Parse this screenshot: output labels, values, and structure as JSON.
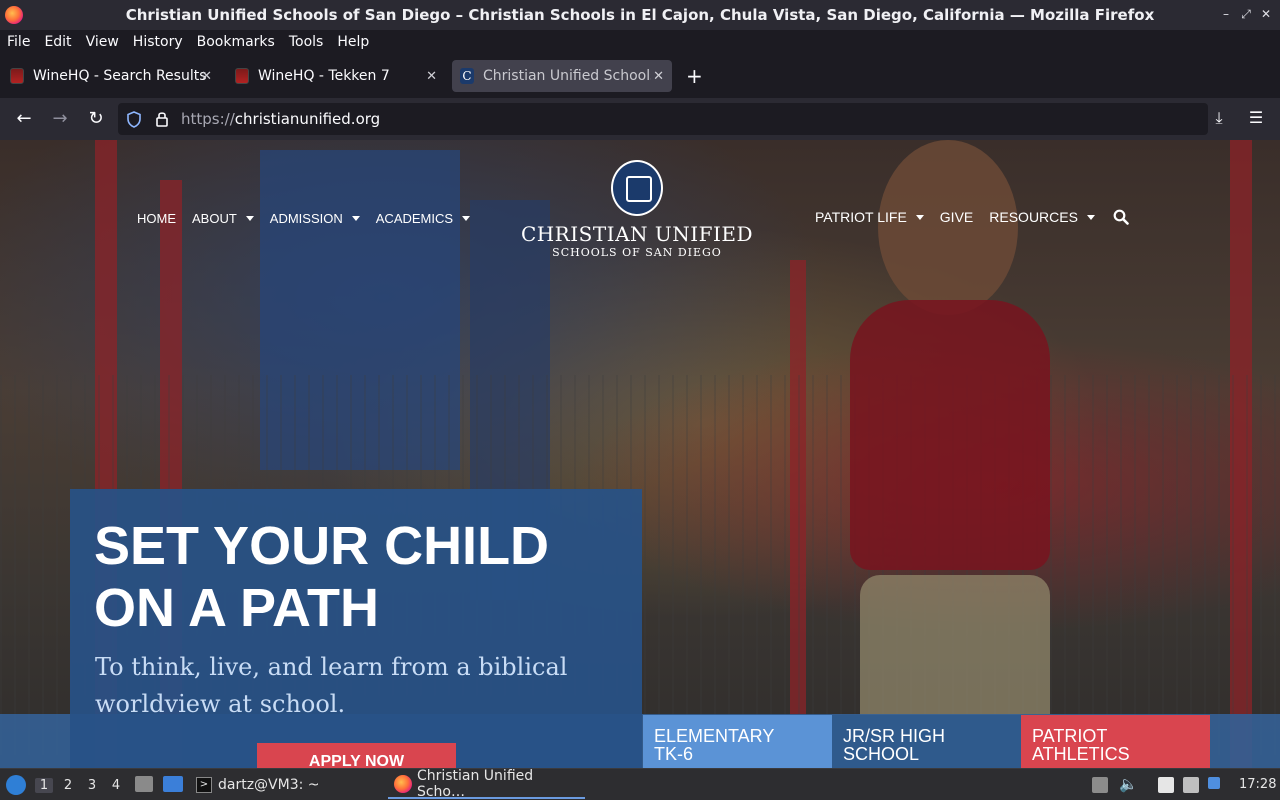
{
  "window": {
    "title": "Christian Unified Schools of San Diego – Christian Schools in El Cajon, Chula Vista, San Diego, California — Mozilla Firefox",
    "controls": [
      "–",
      "⤢",
      "✕"
    ]
  },
  "menu": {
    "items": [
      "File",
      "Edit",
      "View",
      "History",
      "Bookmarks",
      "Tools",
      "Help"
    ]
  },
  "tabs": [
    {
      "label": "WineHQ - Search Results",
      "icon": "wine-icon"
    },
    {
      "label": "WineHQ - Tekken 7",
      "icon": "wine-icon"
    },
    {
      "label": "Christian Unified Schools",
      "icon": "cu-favicon"
    }
  ],
  "toolbar": {
    "new_tab": "+",
    "back": "←",
    "forward": "→",
    "reload": "↻",
    "url_protocol": "https://",
    "url_host": "christianunified.org"
  },
  "site": {
    "nav_left": [
      "HOME",
      "ABOUT",
      "ADMISSION",
      "ACADEMICS"
    ],
    "nav_right": [
      "PATRIOT LIFE",
      "GIVE",
      "RESOURCES"
    ],
    "logo_name": "CHRISTIAN UNIFIED",
    "logo_sub": "SCHOOLS OF SAN DIEGO",
    "hero_title_line1": "SET YOUR CHILD",
    "hero_title_line2": "ON A PATH",
    "hero_sub_line1": "To think, live, and learn from a biblical",
    "hero_sub_line2": "worldview at school.",
    "apply": "APPLY NOW",
    "tiles": [
      {
        "line1": "ELEMENTARY",
        "line2": "TK-6"
      },
      {
        "line1": "JR/SR HIGH",
        "line2": "SCHOOL"
      },
      {
        "line1": "PATRIOT",
        "line2": "ATHLETICS"
      }
    ]
  },
  "taskbar": {
    "workspaces": [
      "1",
      "2",
      "3",
      "4"
    ],
    "terminal": "dartz@VM3: ~",
    "firefox": "Christian Unified Scho…",
    "clock": "17:28"
  },
  "colors": {
    "hero_card": "#285287",
    "apply": "#d9454f",
    "tile_elementary": "#5b93d6",
    "tile_high": "#2f5a8c",
    "tile_athletics": "#d9454f"
  }
}
